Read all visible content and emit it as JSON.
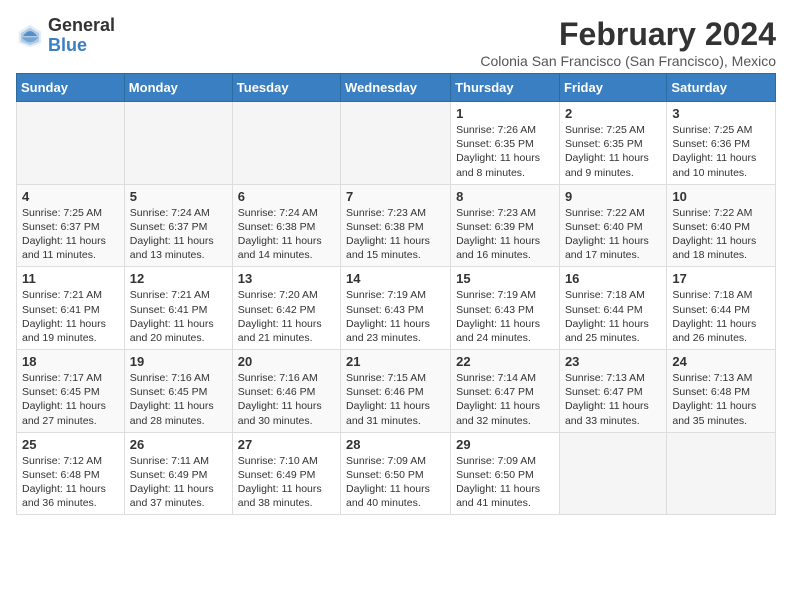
{
  "logo": {
    "general": "General",
    "blue": "Blue"
  },
  "header": {
    "title": "February 2024",
    "subtitle": "Colonia San Francisco (San Francisco), Mexico"
  },
  "weekdays": [
    "Sunday",
    "Monday",
    "Tuesday",
    "Wednesday",
    "Thursday",
    "Friday",
    "Saturday"
  ],
  "weeks": [
    [
      {
        "day": "",
        "info": ""
      },
      {
        "day": "",
        "info": ""
      },
      {
        "day": "",
        "info": ""
      },
      {
        "day": "",
        "info": ""
      },
      {
        "day": "1",
        "info": "Sunrise: 7:26 AM\nSunset: 6:35 PM\nDaylight: 11 hours and 8 minutes."
      },
      {
        "day": "2",
        "info": "Sunrise: 7:25 AM\nSunset: 6:35 PM\nDaylight: 11 hours and 9 minutes."
      },
      {
        "day": "3",
        "info": "Sunrise: 7:25 AM\nSunset: 6:36 PM\nDaylight: 11 hours and 10 minutes."
      }
    ],
    [
      {
        "day": "4",
        "info": "Sunrise: 7:25 AM\nSunset: 6:37 PM\nDaylight: 11 hours and 11 minutes."
      },
      {
        "day": "5",
        "info": "Sunrise: 7:24 AM\nSunset: 6:37 PM\nDaylight: 11 hours and 13 minutes."
      },
      {
        "day": "6",
        "info": "Sunrise: 7:24 AM\nSunset: 6:38 PM\nDaylight: 11 hours and 14 minutes."
      },
      {
        "day": "7",
        "info": "Sunrise: 7:23 AM\nSunset: 6:38 PM\nDaylight: 11 hours and 15 minutes."
      },
      {
        "day": "8",
        "info": "Sunrise: 7:23 AM\nSunset: 6:39 PM\nDaylight: 11 hours and 16 minutes."
      },
      {
        "day": "9",
        "info": "Sunrise: 7:22 AM\nSunset: 6:40 PM\nDaylight: 11 hours and 17 minutes."
      },
      {
        "day": "10",
        "info": "Sunrise: 7:22 AM\nSunset: 6:40 PM\nDaylight: 11 hours and 18 minutes."
      }
    ],
    [
      {
        "day": "11",
        "info": "Sunrise: 7:21 AM\nSunset: 6:41 PM\nDaylight: 11 hours and 19 minutes."
      },
      {
        "day": "12",
        "info": "Sunrise: 7:21 AM\nSunset: 6:41 PM\nDaylight: 11 hours and 20 minutes."
      },
      {
        "day": "13",
        "info": "Sunrise: 7:20 AM\nSunset: 6:42 PM\nDaylight: 11 hours and 21 minutes."
      },
      {
        "day": "14",
        "info": "Sunrise: 7:19 AM\nSunset: 6:43 PM\nDaylight: 11 hours and 23 minutes."
      },
      {
        "day": "15",
        "info": "Sunrise: 7:19 AM\nSunset: 6:43 PM\nDaylight: 11 hours and 24 minutes."
      },
      {
        "day": "16",
        "info": "Sunrise: 7:18 AM\nSunset: 6:44 PM\nDaylight: 11 hours and 25 minutes."
      },
      {
        "day": "17",
        "info": "Sunrise: 7:18 AM\nSunset: 6:44 PM\nDaylight: 11 hours and 26 minutes."
      }
    ],
    [
      {
        "day": "18",
        "info": "Sunrise: 7:17 AM\nSunset: 6:45 PM\nDaylight: 11 hours and 27 minutes."
      },
      {
        "day": "19",
        "info": "Sunrise: 7:16 AM\nSunset: 6:45 PM\nDaylight: 11 hours and 28 minutes."
      },
      {
        "day": "20",
        "info": "Sunrise: 7:16 AM\nSunset: 6:46 PM\nDaylight: 11 hours and 30 minutes."
      },
      {
        "day": "21",
        "info": "Sunrise: 7:15 AM\nSunset: 6:46 PM\nDaylight: 11 hours and 31 minutes."
      },
      {
        "day": "22",
        "info": "Sunrise: 7:14 AM\nSunset: 6:47 PM\nDaylight: 11 hours and 32 minutes."
      },
      {
        "day": "23",
        "info": "Sunrise: 7:13 AM\nSunset: 6:47 PM\nDaylight: 11 hours and 33 minutes."
      },
      {
        "day": "24",
        "info": "Sunrise: 7:13 AM\nSunset: 6:48 PM\nDaylight: 11 hours and 35 minutes."
      }
    ],
    [
      {
        "day": "25",
        "info": "Sunrise: 7:12 AM\nSunset: 6:48 PM\nDaylight: 11 hours and 36 minutes."
      },
      {
        "day": "26",
        "info": "Sunrise: 7:11 AM\nSunset: 6:49 PM\nDaylight: 11 hours and 37 minutes."
      },
      {
        "day": "27",
        "info": "Sunrise: 7:10 AM\nSunset: 6:49 PM\nDaylight: 11 hours and 38 minutes."
      },
      {
        "day": "28",
        "info": "Sunrise: 7:09 AM\nSunset: 6:50 PM\nDaylight: 11 hours and 40 minutes."
      },
      {
        "day": "29",
        "info": "Sunrise: 7:09 AM\nSunset: 6:50 PM\nDaylight: 11 hours and 41 minutes."
      },
      {
        "day": "",
        "info": ""
      },
      {
        "day": "",
        "info": ""
      }
    ]
  ]
}
